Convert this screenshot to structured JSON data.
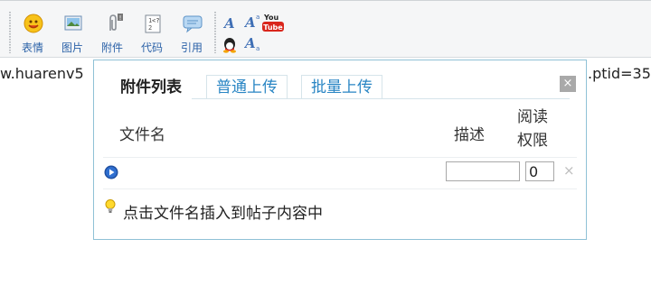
{
  "toolbar": {
    "tools": [
      {
        "label": "表情",
        "icon": "smiley-icon"
      },
      {
        "label": "图片",
        "icon": "image-icon"
      },
      {
        "label": "附件",
        "icon": "paperclip-icon"
      },
      {
        "label": "代码",
        "icon": "code-icon"
      },
      {
        "label": "引用",
        "icon": "quote-icon"
      }
    ],
    "format_icons": [
      "font-icon",
      "superscript-font-icon",
      "youtube-icon",
      "qq-icon",
      "subscript-font-icon"
    ],
    "youtube_text_top": "You",
    "youtube_text_bottom": "Tube"
  },
  "background": {
    "url_left": "w.huarenv5",
    "url_right": ".ptid=35"
  },
  "popup": {
    "tabs": [
      "附件列表",
      "普通上传",
      "批量上传"
    ],
    "active_tab": "附件列表",
    "close_label": "×",
    "columns": {
      "name": "文件名",
      "description": "描述",
      "permission_line1": "阅读",
      "permission_line2": "权限"
    },
    "row": {
      "description_value": "",
      "permission_value": "0",
      "delete_label": "×"
    },
    "hint": "点击文件名插入到帖子内容中"
  },
  "colors": {
    "toolbar_label": "#2c62a8",
    "tab_link": "#2a86c4",
    "popup_border": "#8fc1d6"
  }
}
